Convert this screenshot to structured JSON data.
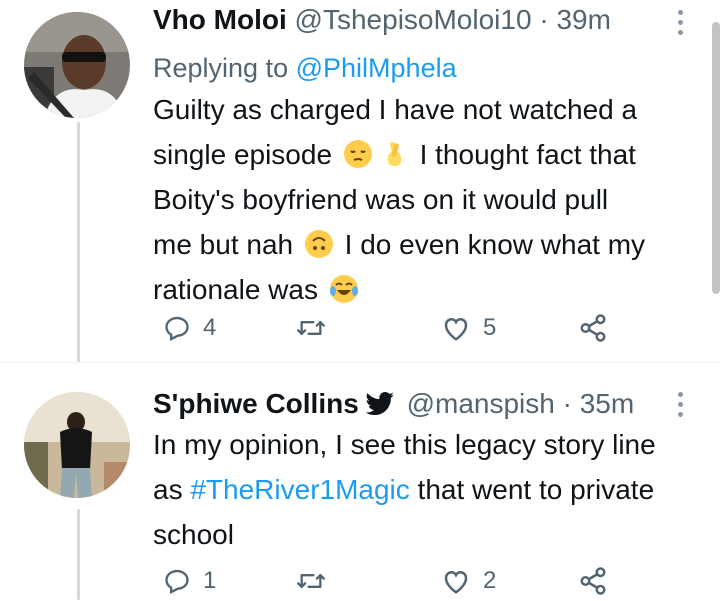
{
  "tweets": [
    {
      "name": "Vho Moloi",
      "handle": "@TshepisoMoloi10",
      "separator": "·",
      "time": "39m",
      "replying_label": "Replying to",
      "replying_to": "@PhilMphela",
      "text_lines": [
        [
          "Guilty as charged I have not watched a"
        ],
        [
          "single episode",
          " I thought fact that"
        ],
        [
          "Boity's boyfriend was on it would pull"
        ],
        [
          "me but nah",
          " I do even know what my"
        ],
        [
          "rationale was"
        ]
      ],
      "emojis": [
        "pensive-face",
        "crossed-fingers",
        "upside-down-face",
        "tears-of-joy-face"
      ],
      "replies": "4",
      "retweets": "",
      "likes": "5"
    },
    {
      "name": "S'phiwe Collins",
      "verified_icon": "twitter-bird-icon",
      "handle": "@manspish",
      "separator": "·",
      "time": "35m",
      "text_line1": "In my opinion, I see this legacy story line",
      "text_line2_pre": "as ",
      "hashtag": "#TheRiver1Magic",
      "text_line2_post": " that went to private",
      "text_line3": "school",
      "replies": "1",
      "retweets": "",
      "likes": "2"
    }
  ],
  "colors": {
    "accent": "#1d9bf0",
    "secondary_text": "#536471",
    "thread_line": "#cfd9de"
  }
}
